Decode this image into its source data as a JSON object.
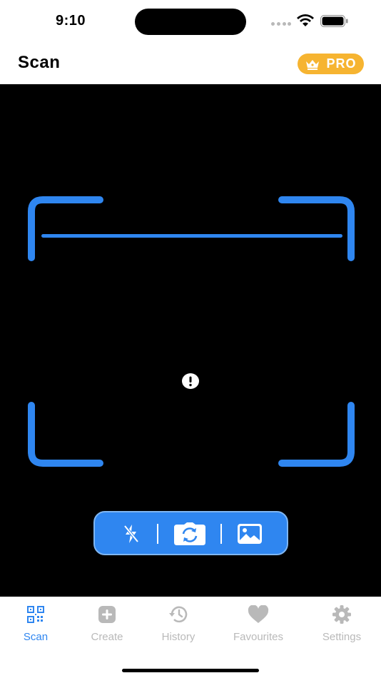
{
  "status_bar": {
    "time": "9:10"
  },
  "header": {
    "title": "Scan",
    "pro_label": "PRO",
    "pro_icon": "crown-icon"
  },
  "camera": {
    "alert_icon": "exclamation-circle-icon",
    "tools": [
      {
        "name": "flash-off-icon"
      },
      {
        "name": "camera-rotate-icon"
      },
      {
        "name": "photo-gallery-icon"
      }
    ]
  },
  "tabs": [
    {
      "label": "Scan",
      "icon": "qr-code-icon",
      "active": true
    },
    {
      "label": "Create",
      "icon": "plus-square-icon",
      "active": false
    },
    {
      "label": "History",
      "icon": "history-clock-icon",
      "active": false
    },
    {
      "label": "Favourites",
      "icon": "heart-icon",
      "active": false
    },
    {
      "label": "Settings",
      "icon": "gear-icon",
      "active": false
    }
  ],
  "colors": {
    "accent": "#2f86f0",
    "pro_badge": "#f6b431",
    "inactive_tab": "#b9b9b9",
    "camera_bg": "#000000"
  }
}
